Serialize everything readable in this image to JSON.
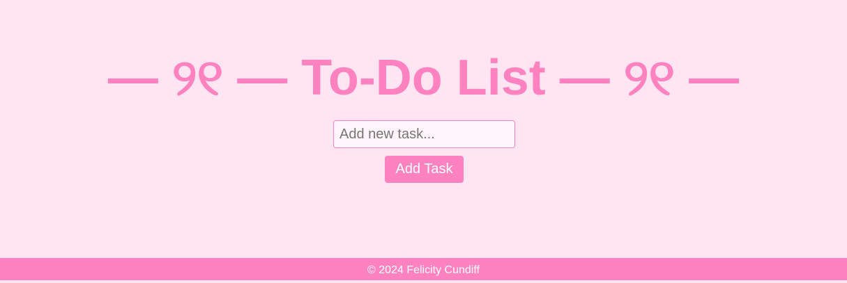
{
  "header": {
    "title": "— ୨୧ — To-Do List — ୨୧ —"
  },
  "task_form": {
    "input_value": "",
    "input_placeholder": "Add new task...",
    "add_button_label": "Add Task"
  },
  "footer": {
    "copyright": "© 2024 Felicity Cundiff"
  },
  "colors": {
    "background": "#ffe4f1",
    "accent": "#ff82c0",
    "input_background": "#fff5fa",
    "button_text": "#ffffff"
  }
}
